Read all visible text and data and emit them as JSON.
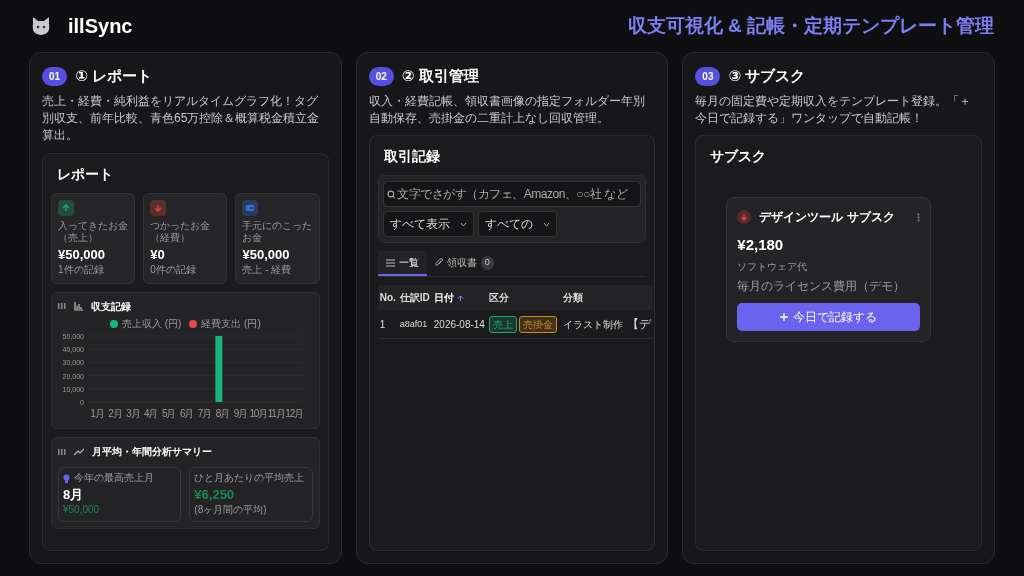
{
  "app": {
    "name": "illSync",
    "tagline": "収支可視化 & 記帳・定期テンプレート管理"
  },
  "features": [
    {
      "kind": "report",
      "number": "01",
      "title": "① レポート",
      "description": "売上・経費・純利益をリアルタイムグラフ化！タグ別収支、前年比較、青色65万控除＆概算税金積立金算出。",
      "screen": {
        "title": "レポート",
        "stat_cards": [
          {
            "kind": "income",
            "label": "入ってきたお金（売上）",
            "amount": "¥50,000",
            "note": "1件の記録",
            "color": "#1fa971"
          },
          {
            "kind": "expense",
            "label": "つかったお金（経費）",
            "amount": "¥0",
            "note": "0件の記録",
            "color": "#d9463e"
          },
          {
            "kind": "balance",
            "label": "手元にのこったお金",
            "amount": "¥50,000",
            "note": "売上 - 経費",
            "color": "#3b6fd8"
          }
        ],
        "chart_panel": {
          "title": "収支記録",
          "chart_data": {
            "type": "bar",
            "categories": [
              "1月",
              "2月",
              "3月",
              "4月",
              "5月",
              "6月",
              "7月",
              "8月",
              "9月",
              "10月",
              "11月",
              "12月"
            ],
            "series": [
              {
                "name": "売上収入 (円)",
                "color": "#19b47a",
                "values": [
                  0,
                  0,
                  0,
                  0,
                  0,
                  0,
                  0,
                  50000,
                  0,
                  0,
                  0,
                  0
                ]
              },
              {
                "name": "経費支出 (円)",
                "color": "#e5484d",
                "values": [
                  0,
                  0,
                  0,
                  0,
                  0,
                  0,
                  0,
                  0,
                  0,
                  0,
                  0,
                  0
                ]
              }
            ],
            "grid": true,
            "ylim": [
              0,
              50000
            ],
            "yticks": [
              0,
              {
                "value": 10000,
                "label": "10,000"
              },
              {
                "value": 20000,
                "label": "20,000"
              },
              {
                "value": 30000,
                "label": "30,000"
              },
              {
                "value": 40000,
                "label": "40,000"
              },
              {
                "value": 50000,
                "label": "50,000"
              }
            ]
          }
        },
        "summary": {
          "title": "月平均・年間分析サマリー",
          "items": [
            {
              "kind": "best_month",
              "label": "今年の最高売上月",
              "value": "8月",
              "note": "¥50,000"
            },
            {
              "kind": "average",
              "label": "ひと月あたりの平均売上",
              "value": "¥6,250",
              "note": "(8ヶ月間の平均)"
            }
          ]
        }
      }
    },
    {
      "kind": "ledger",
      "number": "02",
      "title": "② 取引管理",
      "description": "収入・経費記帳、領収書画像の指定フォルダー年別自動保存、売掛金の二重計上なし回収管理。",
      "screen": {
        "title": "取引記録",
        "search": {
          "placeholder": "文字でさがす（カフェ、Amazon、○○社 など"
        },
        "filters": [
          "すべて表示",
          "すべての"
        ],
        "tabs": [
          {
            "label": "一覧",
            "selected": true
          },
          {
            "label": "領収書",
            "count": "0",
            "selected": false
          }
        ],
        "table": {
          "columns": [
            {
              "label": "No.",
              "sorted": false
            },
            {
              "label": "仕訳ID",
              "sorted": false
            },
            {
              "label": "日付",
              "sorted": true
            },
            {
              "label": "区分",
              "sorted": false
            },
            {
              "label": "分類",
              "sorted": false
            }
          ],
          "rows": [
            {
              "no": "1",
              "id": "a8af01",
              "date": "2026-08-14",
              "tags": [
                {
                  "label": "売上",
                  "color": "#1fa971"
                },
                {
                  "label": "売掛金",
                  "color": "#d08a1c"
                }
              ],
              "category": "イラスト制作",
              "column_6": "【デ"
            }
          ]
        }
      }
    },
    {
      "kind": "subscription",
      "number": "03",
      "title": "③ サブスク",
      "description": "毎月の固定費や定期収入をテンプレート登録。「＋今日で記録する」ワンタップで自動記帳！",
      "screen": {
        "title": "サブスク",
        "card": {
          "name": "デザインツール サブスク",
          "amount": "¥2,180",
          "category": "ソフトウェア代",
          "note": "毎月のライセンス費用（デモ）",
          "button": "今日で記録する"
        }
      }
    }
  ]
}
